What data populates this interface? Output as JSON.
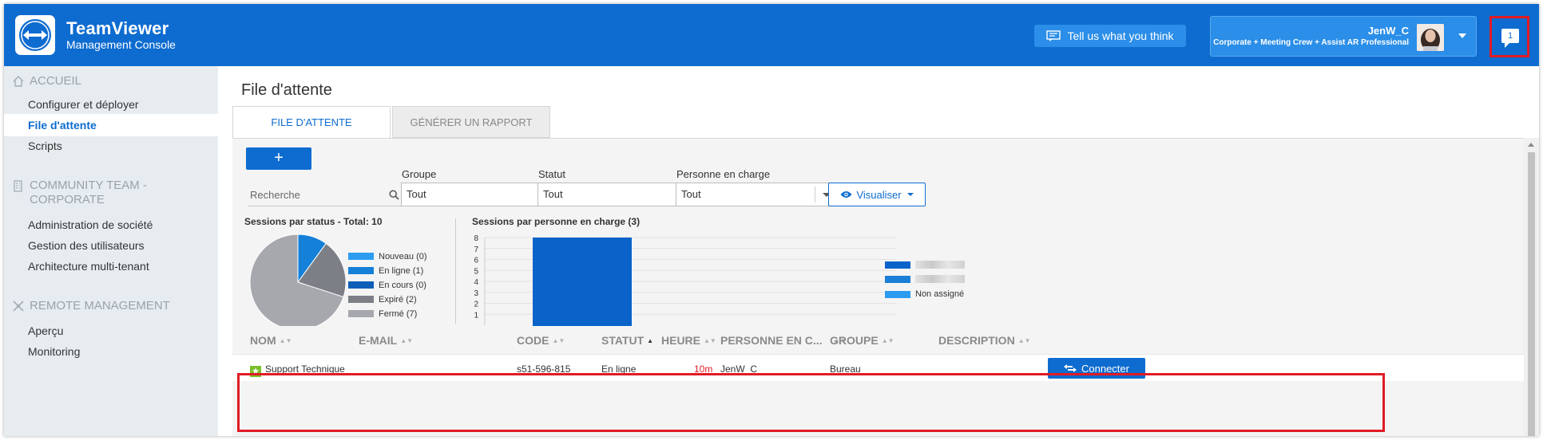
{
  "header": {
    "brand_title": "TeamViewer",
    "brand_subtitle": "Management Console",
    "feedback_label": "Tell us what you think",
    "user_name": "JenW_C",
    "license": "Corporate + Meeting Crew + Assist AR Professional",
    "notification_count": "1"
  },
  "sidebar": {
    "sections": [
      {
        "title": "ACCUEIL",
        "icon": "home-icon"
      },
      {
        "title": "COMMUNITY TEAM - CORPORATE",
        "icon": "building-icon"
      },
      {
        "title": "REMOTE MANAGEMENT",
        "icon": "remote-management-icon"
      }
    ],
    "items": [
      {
        "label": "Configurer et déployer"
      },
      {
        "label": "File d'attente",
        "active": true
      },
      {
        "label": "Scripts"
      },
      {
        "label": "Administration de société"
      },
      {
        "label": "Gestion des utilisateurs"
      },
      {
        "label": "Architecture multi-tenant"
      },
      {
        "label": "Aperçu"
      },
      {
        "label": "Monitoring"
      }
    ]
  },
  "main": {
    "title": "File d'attente",
    "tabs": [
      {
        "label": "FILE D'ATTENTE",
        "active": true
      },
      {
        "label": "GÉNÉRER UN RAPPORT"
      }
    ],
    "add_label": "+",
    "search_placeholder": "Recherche",
    "filters": [
      {
        "label": "Groupe",
        "value": "Tout"
      },
      {
        "label": "Statut",
        "value": "Tout"
      },
      {
        "label": "Personne en charge",
        "value": "Tout"
      }
    ],
    "view_label": "Visualiser"
  },
  "chart_data": [
    {
      "type": "pie",
      "title": "Sessions par status - Total: 10",
      "series": [
        {
          "name": "Nouveau (0)",
          "value": 0,
          "color": "#2b9cf0"
        },
        {
          "name": "En ligne (1)",
          "value": 1,
          "color": "#1480d8"
        },
        {
          "name": "En cours (0)",
          "value": 0,
          "color": "#0d5fb8"
        },
        {
          "name": "Expiré (2)",
          "value": 2,
          "color": "#7d7f87"
        },
        {
          "name": "Fermé (7)",
          "value": 7,
          "color": "#a6a8ad"
        }
      ],
      "legend": "right"
    },
    {
      "type": "bar",
      "title": "Sessions par personne en charge (3)",
      "categories": [
        ""
      ],
      "series": [
        {
          "values": [
            8
          ],
          "color": "#0a63c9"
        }
      ],
      "ylim": [
        0,
        8
      ],
      "yticks": [
        "1",
        "2",
        "3",
        "4",
        "5",
        "6",
        "7",
        "8"
      ],
      "grid": true,
      "legend_entries": [
        {
          "name": "",
          "color": "#0a63c9",
          "redacted": true
        },
        {
          "name": "",
          "color": "#1a7fd6",
          "redacted": true
        },
        {
          "name": "Non assigné",
          "color": "#2b9cf0"
        }
      ]
    }
  ],
  "table": {
    "columns": [
      "NOM",
      "E-MAIL",
      "CODE",
      "STATUT",
      "HEURE",
      "PERSONNE EN C...",
      "GROUPE",
      "DESCRIPTION"
    ],
    "rows": [
      {
        "name": "Support Technique",
        "email": "",
        "code": "s51-596-815",
        "status": "En ligne",
        "time": "10m",
        "assignee": "JenW_C",
        "group": "Bureau",
        "description": "",
        "action": "Connecter"
      }
    ]
  },
  "colors": {
    "brand": "#0e6cd0",
    "highlight": "#e01b24",
    "time_warning": "#e01b24"
  }
}
